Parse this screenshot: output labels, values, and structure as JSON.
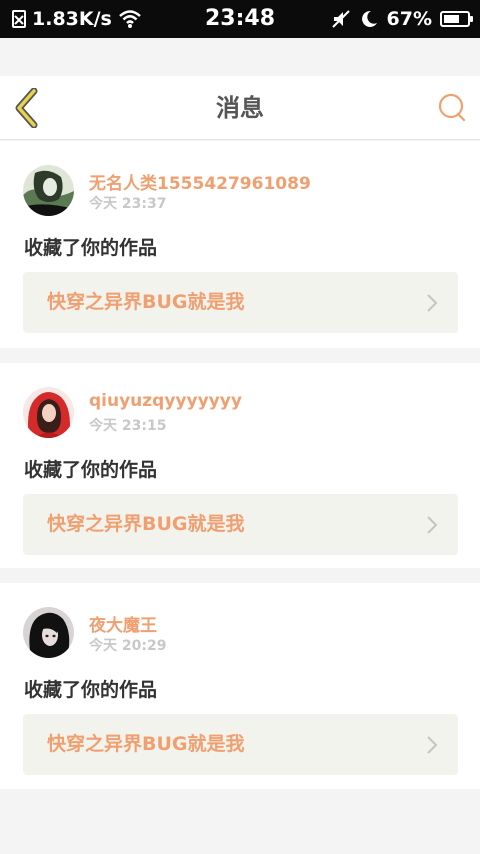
{
  "status_bar": {
    "network_speed": "1.83K/s",
    "time": "23:48",
    "battery": "67%",
    "battery_level": 0.67,
    "icons": [
      "no-sim-icon",
      "wifi-icon",
      "mute-icon",
      "night-mode-icon",
      "battery-icon"
    ]
  },
  "header": {
    "title": "消息",
    "back_icon": "chevron-left-icon",
    "search_icon": "search-icon"
  },
  "colors": {
    "accent": "#f0a070",
    "back": "#d8c020",
    "text": "#333333",
    "muted": "#c8c8c8",
    "card_link_bg": "#f3f3ee"
  },
  "messages": [
    {
      "username": "无名人类1555427961089",
      "time": "今天 23:37",
      "action": "收藏了你的作品",
      "work_title": "快穿之异界BUG就是我"
    },
    {
      "username": "qiuyuzqyyyyyyy",
      "time": "今天 23:15",
      "action": "收藏了你的作品",
      "work_title": "快穿之异界BUG就是我"
    },
    {
      "username": "夜大魔王",
      "time": "今天 20:29",
      "action": "收藏了你的作品",
      "work_title": "快穿之异界BUG就是我"
    }
  ]
}
